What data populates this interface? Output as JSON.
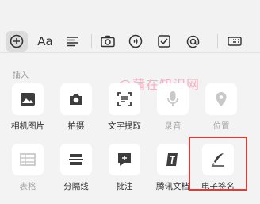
{
  "toolbar": {
    "icons": [
      "plus-circle-icon",
      "text-format-icon",
      "align-icon",
      "camera-icon",
      "voice-icon",
      "checkbox-icon",
      "mention-icon",
      "keyboard-icon"
    ],
    "aa_label": "Aa"
  },
  "panel": {
    "section_label": "插入",
    "watermark": "@蒲在知识网",
    "row1": [
      {
        "label": "相机图片",
        "icon": "image-icon",
        "enabled": true
      },
      {
        "label": "拍摄",
        "icon": "camera-icon",
        "enabled": true
      },
      {
        "label": "文字提取",
        "icon": "text-scan-icon",
        "enabled": true
      },
      {
        "label": "录音",
        "icon": "microphone-icon",
        "enabled": false
      },
      {
        "label": "位置",
        "icon": "location-pin-icon",
        "enabled": false
      }
    ],
    "row2": [
      {
        "label": "表格",
        "icon": "table-icon",
        "enabled": false
      },
      {
        "label": "分隔线",
        "icon": "divider-icon",
        "enabled": true
      },
      {
        "label": "批注",
        "icon": "comment-add-icon",
        "enabled": true
      },
      {
        "label": "腾讯文档",
        "icon": "tencent-docs-icon",
        "enabled": true
      },
      {
        "label": "电子签名",
        "icon": "signature-pen-icon",
        "enabled": true
      }
    ]
  },
  "colors": {
    "highlight": "#e53935",
    "watermark": "#f7a9bf"
  }
}
